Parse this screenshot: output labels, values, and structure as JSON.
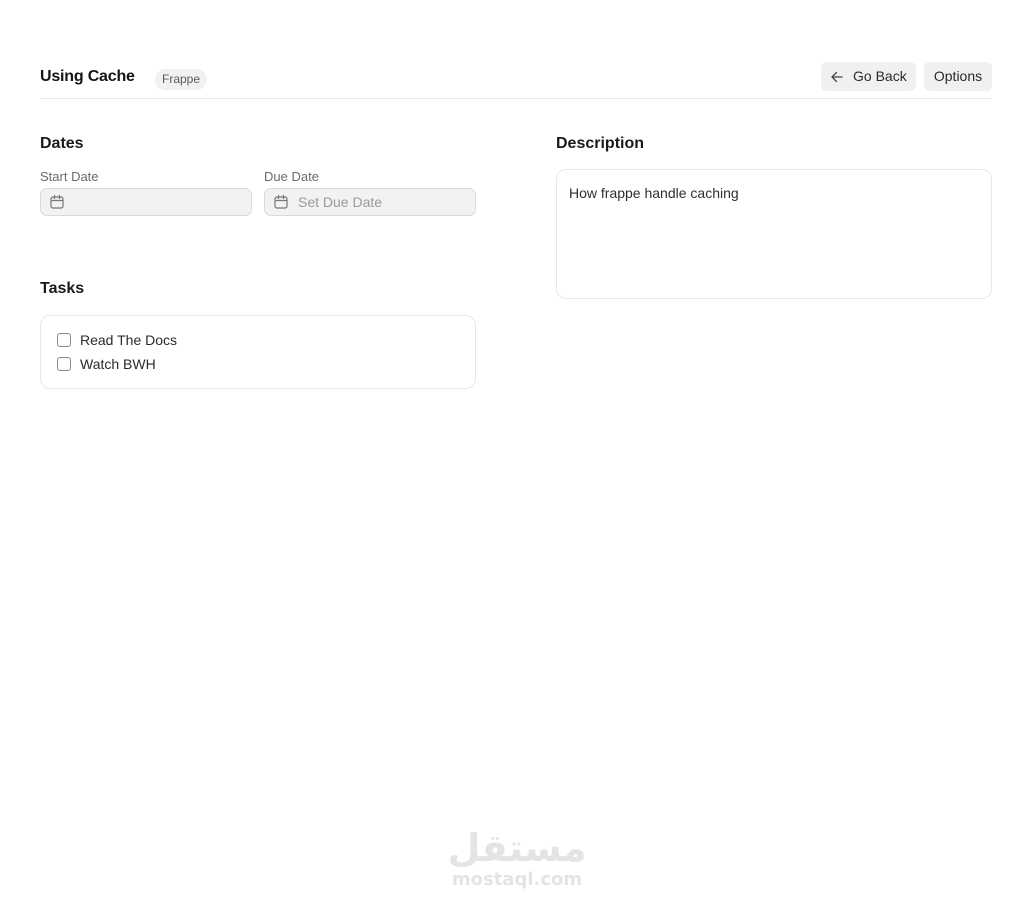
{
  "header": {
    "title": "Using Cache",
    "tag": "Frappe",
    "back_label": "Go Back",
    "options_label": "Options"
  },
  "dates": {
    "heading": "Dates",
    "start_label": "Start Date",
    "start_value": "",
    "due_label": "Due Date",
    "due_placeholder": "Set Due Date"
  },
  "tasks": {
    "heading": "Tasks",
    "items": [
      {
        "label": "Read The Docs",
        "checked": false
      },
      {
        "label": "Watch BWH",
        "checked": false
      }
    ]
  },
  "description": {
    "heading": "Description",
    "text": "How frappe handle caching"
  },
  "watermark": {
    "arabic": "مستقل",
    "latin": "mostaql.com"
  },
  "icons": {
    "back": "arrow-left-icon",
    "calendar": "calendar-icon"
  }
}
